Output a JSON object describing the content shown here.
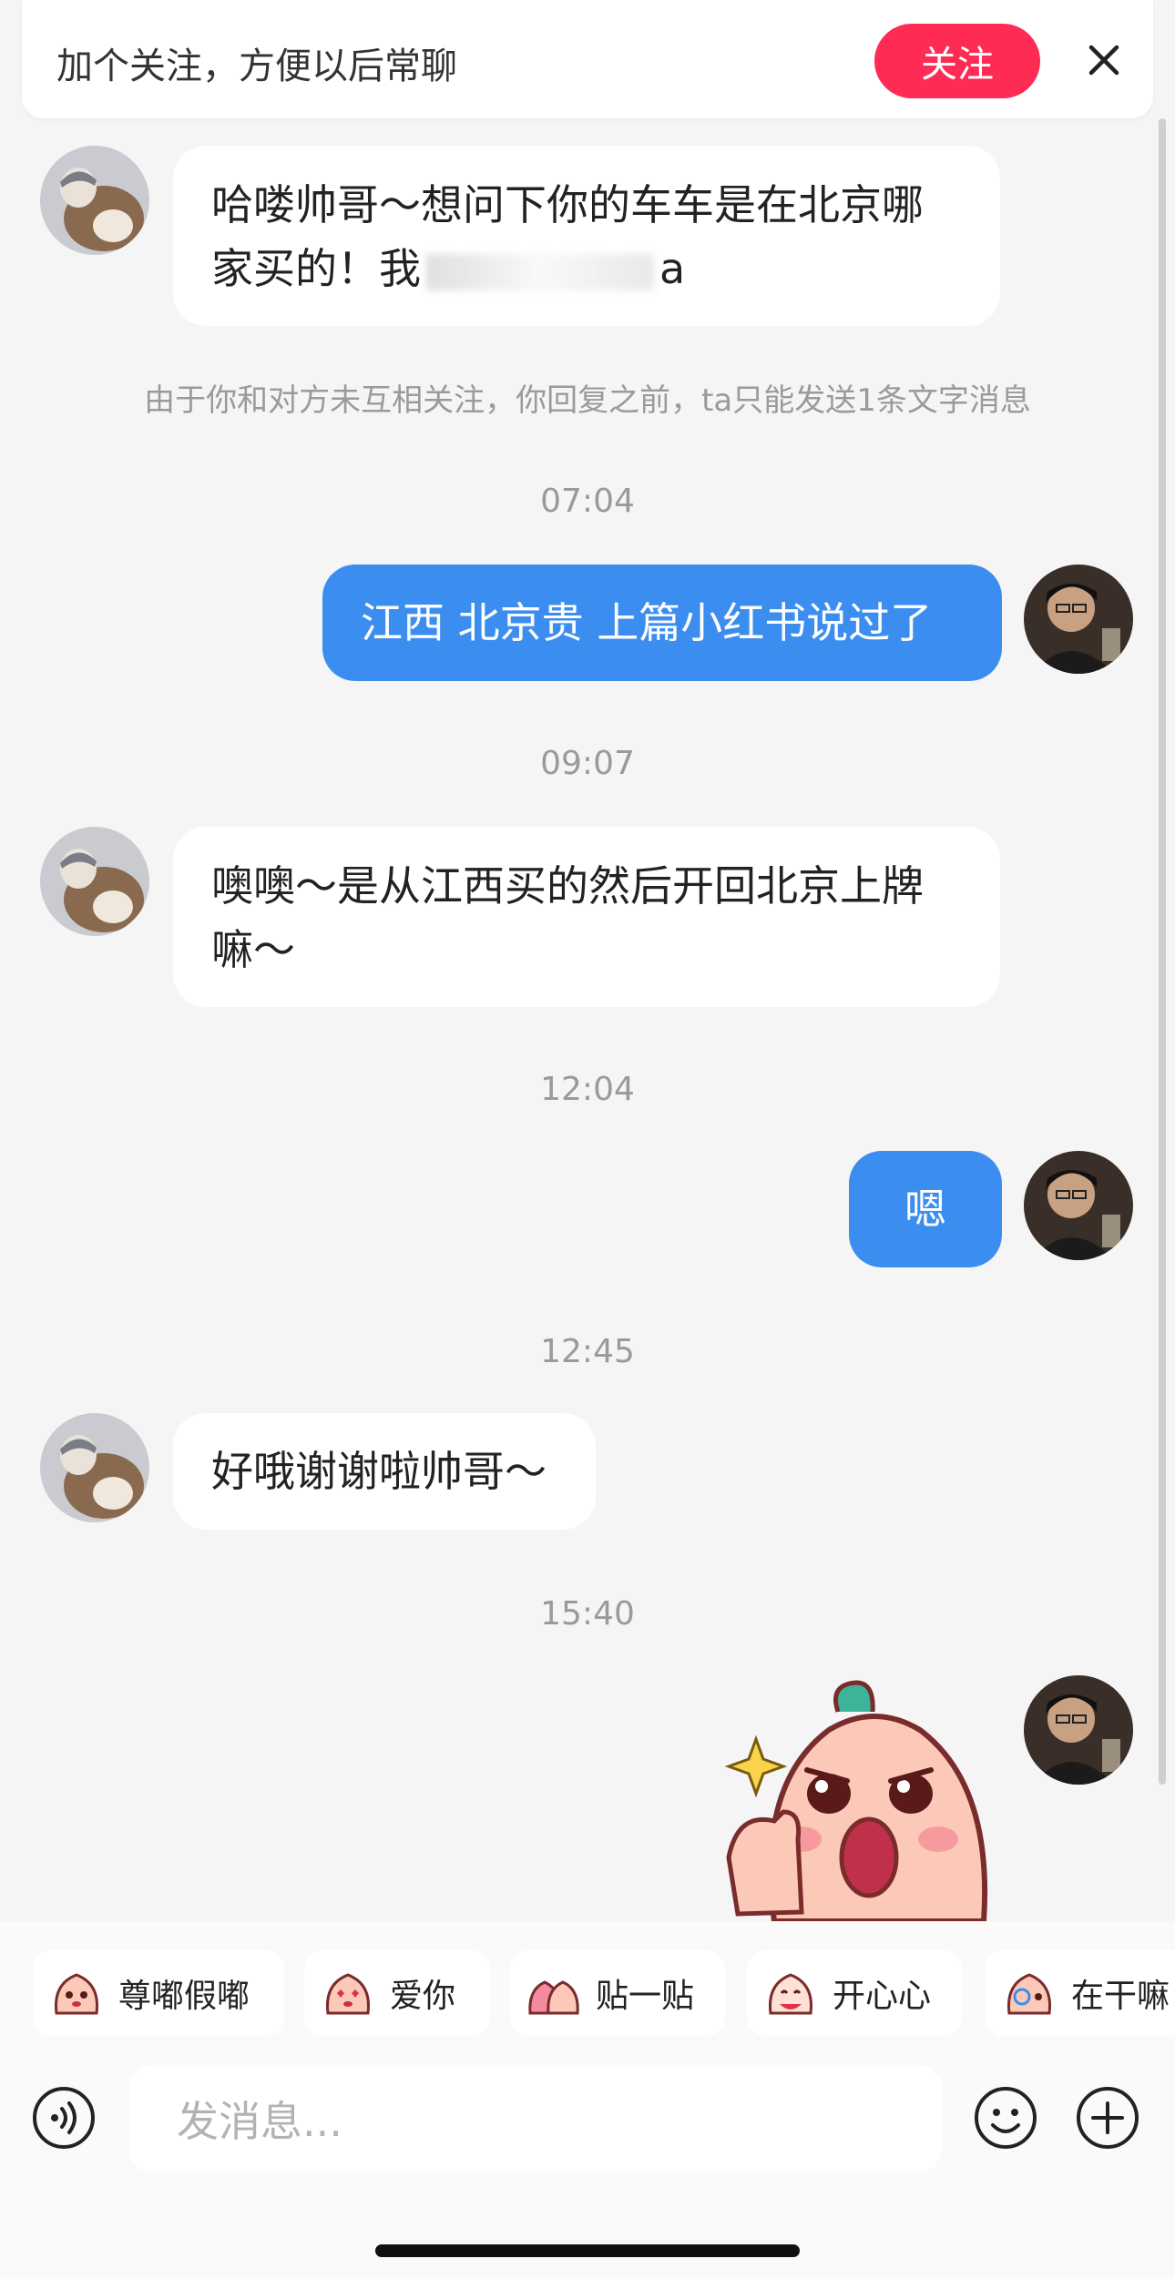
{
  "follow_bar": {
    "text": "加个关注，方便以后常聊",
    "button_label": "关注"
  },
  "notice": "由于你和对方未互相关注，你回复之前，ta只能发送1条文字消息",
  "messages": [
    {
      "side": "in",
      "text_line1": "哈喽帅哥～想问下你的车车是在北京哪",
      "text_line2_prefix": "家买的！我",
      "text_line2_suffix": "a"
    },
    {
      "side": "out",
      "time": "07:04",
      "text": "江西 北京贵 上篇小红书说过了"
    },
    {
      "side": "in",
      "time": "09:07",
      "text_line1": "噢噢～是从江西买的然后开回北京上牌",
      "text_line2": "嘛～"
    },
    {
      "side": "out",
      "time": "12:04",
      "text": "嗯"
    },
    {
      "side": "in",
      "time": "12:45",
      "text": "好哦谢谢啦帅哥～"
    },
    {
      "side": "out",
      "time": "15:40",
      "sticker": "thumbs-up-peach-sticker"
    }
  ],
  "emoji_shortcuts": [
    {
      "label": "尊嘟假嘟",
      "icon": "peach-face-icon"
    },
    {
      "label": "爱你",
      "icon": "peach-love-icon"
    },
    {
      "label": "贴一贴",
      "icon": "peach-hug-icon"
    },
    {
      "label": "开心心",
      "icon": "peach-happy-icon"
    },
    {
      "label": "在干嘛",
      "icon": "peach-question-icon"
    }
  ],
  "input": {
    "placeholder": "发消息..."
  },
  "colors": {
    "accent_red": "#fe2c55",
    "bubble_blue": "#3b8ef0",
    "background": "#f5f5f5"
  }
}
